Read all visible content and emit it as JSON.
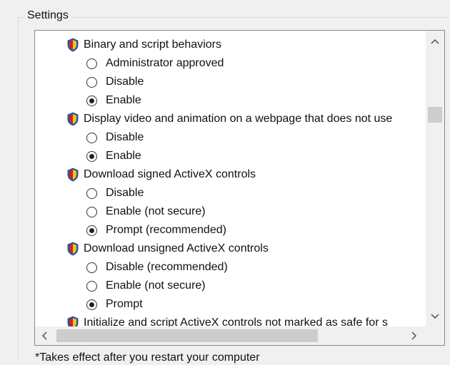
{
  "group": {
    "label": "Settings"
  },
  "settings": {
    "items": [
      {
        "label": "Binary and script behaviors",
        "options": [
          {
            "label": "Administrator approved",
            "checked": false
          },
          {
            "label": "Disable",
            "checked": false
          },
          {
            "label": "Enable",
            "checked": true
          }
        ]
      },
      {
        "label": "Display video and animation on a webpage that does not use",
        "options": [
          {
            "label": "Disable",
            "checked": false
          },
          {
            "label": "Enable",
            "checked": true
          }
        ]
      },
      {
        "label": "Download signed ActiveX controls",
        "options": [
          {
            "label": "Disable",
            "checked": false
          },
          {
            "label": "Enable (not secure)",
            "checked": false
          },
          {
            "label": "Prompt (recommended)",
            "checked": true
          }
        ]
      },
      {
        "label": "Download unsigned ActiveX controls",
        "options": [
          {
            "label": "Disable (recommended)",
            "checked": false
          },
          {
            "label": "Enable (not secure)",
            "checked": false
          },
          {
            "label": "Prompt",
            "checked": true
          }
        ]
      },
      {
        "label": "Initialize and script ActiveX controls not marked as safe for s",
        "options": []
      }
    ]
  },
  "scrollbars": {
    "up_glyph": "^",
    "down_glyph": "v",
    "left_glyph": "<",
    "right_glyph": ">"
  },
  "icons": {
    "setting": "security-shield-icon",
    "radio": "radio-button-icon"
  },
  "colors": {
    "shield_blue": "#1e5bb8",
    "shield_yellow": "#f2c40f",
    "shield_red": "#d42020"
  },
  "footnote": "*Takes effect after you restart your computer"
}
